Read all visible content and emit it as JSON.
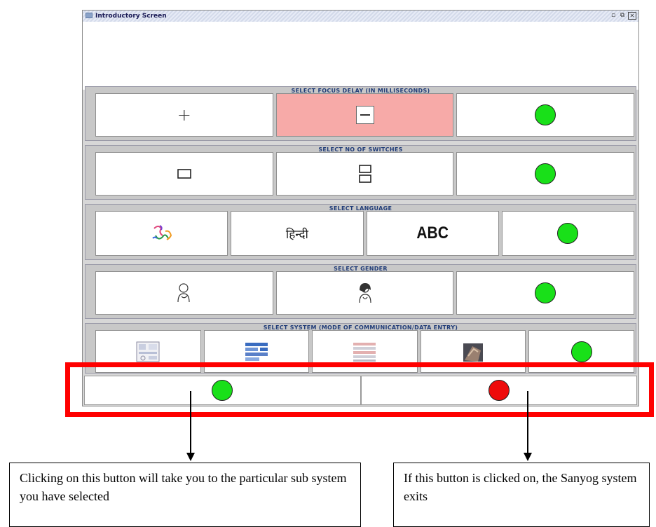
{
  "window": {
    "title": "Introductory Screen",
    "controls": {
      "minimize": "▫",
      "maximize": "⧉",
      "close": "✕"
    }
  },
  "panels": {
    "focus_delay": {
      "title": "SELECT FOCUS DELAY (IN MILLISECONDS)"
    },
    "switches": {
      "title": "SELECT NO OF SWITCHES"
    },
    "language": {
      "title": "SELECT LANGUAGE",
      "hindi": "हिन्दी",
      "english": "ABC"
    },
    "gender": {
      "title": "SELECT GENDER"
    },
    "system": {
      "title": "SELECT SYSTEM (MODE OF COMMUNICATION/DATA ENTRY)"
    }
  },
  "colors": {
    "confirm": "#19e019",
    "exit": "#ee0b0b",
    "highlight": "#ff0000",
    "selected_cell": "#f7aaa8"
  },
  "callouts": {
    "left": "Clicking on this button will take you to the particular sub system you have selected",
    "right": "If this button is clicked on, the Sanyog system exits"
  }
}
